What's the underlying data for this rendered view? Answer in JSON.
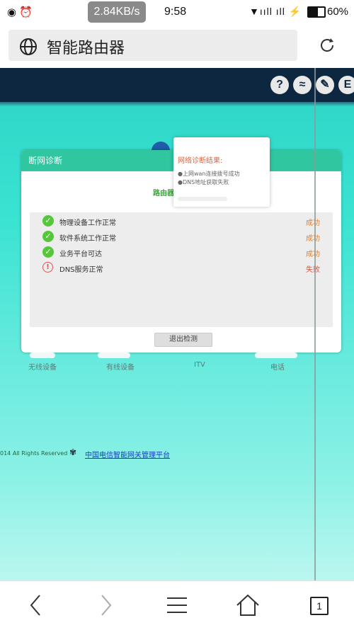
{
  "status_bar": {
    "left_icons": "◉ ⏰",
    "speed": "2.84KB/s",
    "time": "9:58",
    "signal": "▼ııll ıll ⚡",
    "battery_level": 0.6,
    "battery": "60%"
  },
  "browser": {
    "url_title": "智能路由器"
  },
  "header_icons": [
    "?",
    "≈",
    "✎",
    "E"
  ],
  "dialog": {
    "title": "断网诊断",
    "subtitle": "路由器",
    "checks": [
      {
        "label": "物理设备工作正常",
        "status": "成功",
        "ok": true
      },
      {
        "label": "软件系统工作正常",
        "status": "成功",
        "ok": true
      },
      {
        "label": "业务平台可达",
        "status": "成功",
        "ok": true
      },
      {
        "label": "DNS服务正常",
        "status": "失败",
        "ok": false
      }
    ],
    "exit_button": "退出检测"
  },
  "popup": {
    "title": "网络诊断结果:",
    "items": [
      "●上网wan连接拨号成功",
      "●DNS地址获取失败"
    ]
  },
  "devices": [
    "无线设备",
    "有线设备",
    "ITV",
    "电话"
  ],
  "footer": {
    "copyright": "014 All Rights Reserved",
    "link": "中国电信智能网关管理平台"
  },
  "nav": {
    "back": "‹",
    "forward": "›",
    "menu": "≡",
    "home": "⌂",
    "tabs": "1"
  }
}
